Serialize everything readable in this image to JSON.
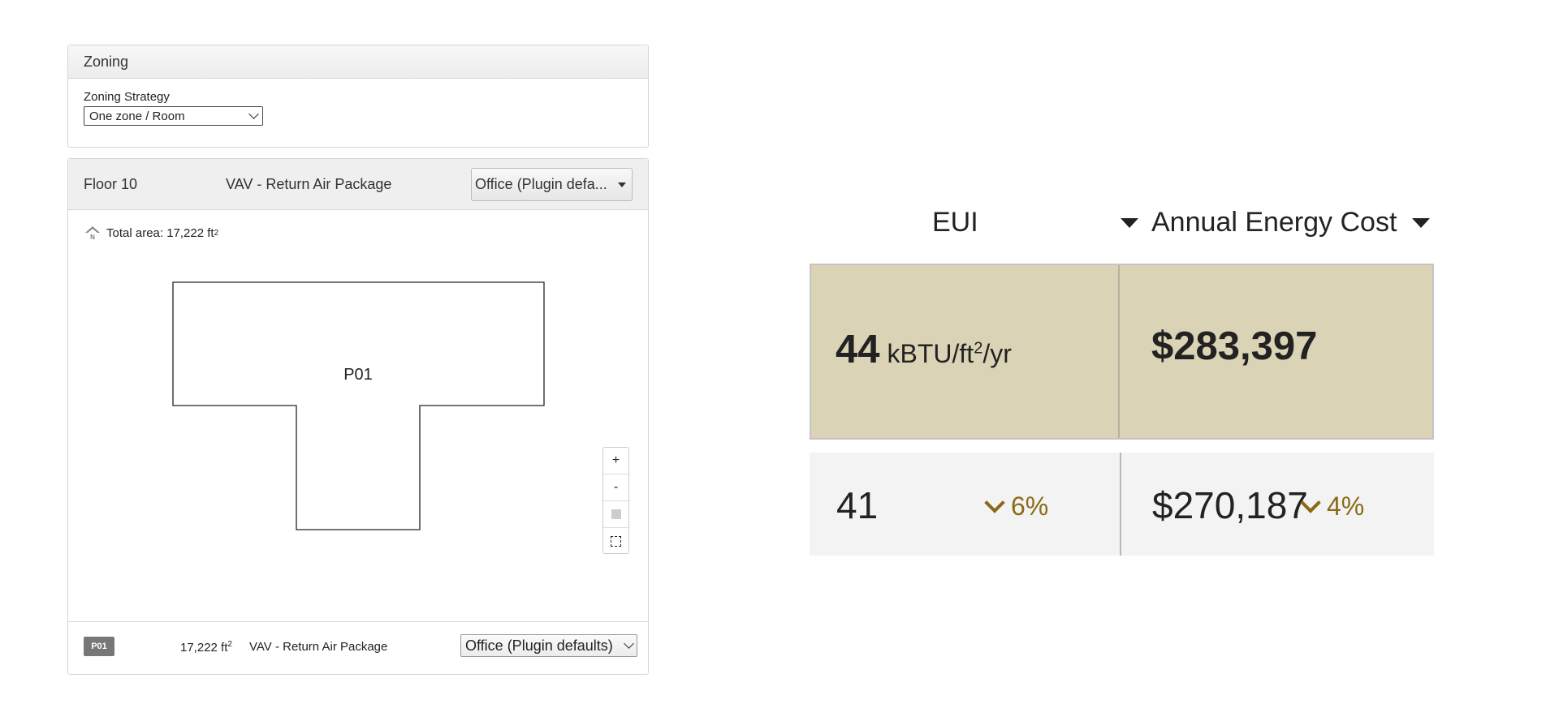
{
  "zoning": {
    "title": "Zoning",
    "strategy_label": "Zoning Strategy",
    "strategy_value": "One zone / Room"
  },
  "floor": {
    "name": "Floor 10",
    "system": "VAV - Return Air Package",
    "space_type": "Office (Plugin defa...",
    "area_prefix": "Total area: 17,222 ft",
    "area_exp": "2",
    "zone_label": "P01",
    "map_controls": {
      "zoom_in": "+",
      "zoom_out": "-"
    },
    "zone_row": {
      "badge": "P01",
      "area": "17,222 ft",
      "area_exp": "2",
      "system": "VAV - Return Air Package",
      "space_type": "Office (Plugin defaults)"
    }
  },
  "metrics": {
    "eui_header": "EUI",
    "cost_header": "Annual Energy Cost",
    "current": {
      "eui_value": "44",
      "eui_unit_a": "kBTU/ft",
      "eui_unit_exp": "2",
      "eui_unit_b": "/yr",
      "cost_value": "$283,397"
    },
    "baseline": {
      "eui_value": "41",
      "eui_change": "6%",
      "cost_value": "$270,187",
      "cost_change": "4%"
    }
  },
  "colors": {
    "current_bg": "#dbd3b5",
    "baseline_bg": "#f3f3f3",
    "change_accent": "#8a6a14"
  }
}
